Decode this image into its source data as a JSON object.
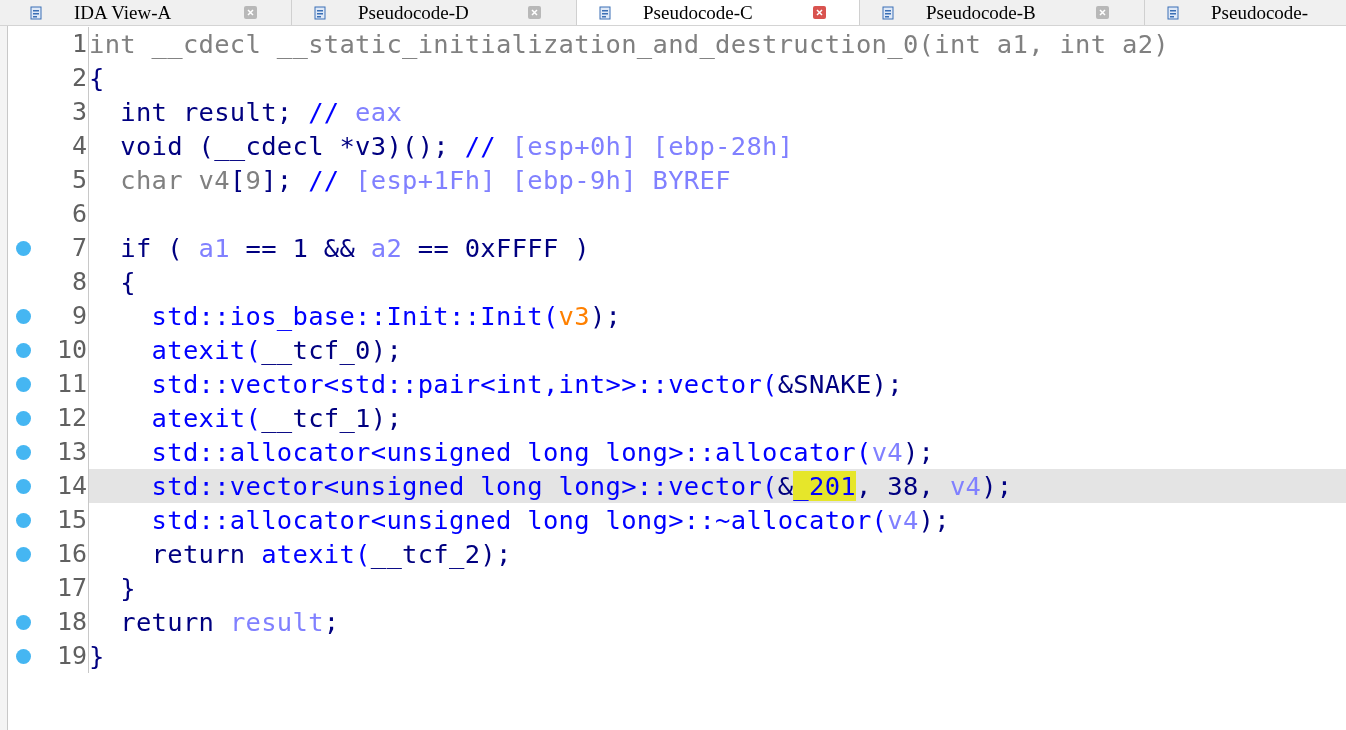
{
  "tabs": [
    {
      "label": "IDA View-A",
      "selected": false
    },
    {
      "label": "Pseudocode-D",
      "selected": false
    },
    {
      "label": "Pseudocode-C",
      "selected": true
    },
    {
      "label": "Pseudocode-B",
      "selected": false
    },
    {
      "label": "Pseudocode-",
      "selected": false
    }
  ],
  "code_lines": [
    {
      "number": "1",
      "breakpoint": false,
      "current": false,
      "tokens": [
        {
          "kind": "gray",
          "text": "int __cdecl __static_initialization_and_destruction_0(int a1, int a2)"
        }
      ]
    },
    {
      "number": "2",
      "breakpoint": false,
      "current": false,
      "tokens": [
        {
          "kind": "plain",
          "text": "{"
        }
      ]
    },
    {
      "number": "3",
      "breakpoint": false,
      "current": false,
      "tokens": [
        {
          "kind": "plain",
          "text": "  int result; "
        },
        {
          "kind": "comment",
          "text": "// "
        },
        {
          "kind": "var",
          "text": "eax"
        }
      ]
    },
    {
      "number": "4",
      "breakpoint": false,
      "current": false,
      "tokens": [
        {
          "kind": "plain",
          "text": "  void (__cdecl *v3)(); "
        },
        {
          "kind": "comment",
          "text": "// "
        },
        {
          "kind": "var",
          "text": "[esp+0h] [ebp-28h]"
        }
      ]
    },
    {
      "number": "5",
      "breakpoint": false,
      "current": false,
      "tokens": [
        {
          "kind": "gray",
          "text": "  char v4"
        },
        {
          "kind": "plain",
          "text": "["
        },
        {
          "kind": "gray",
          "text": "9"
        },
        {
          "kind": "plain",
          "text": "]; "
        },
        {
          "kind": "comment",
          "text": "// "
        },
        {
          "kind": "var",
          "text": "[esp+1Fh] [ebp-9h] BYREF"
        }
      ]
    },
    {
      "number": "6",
      "breakpoint": false,
      "current": false
    },
    {
      "number": "7",
      "breakpoint": true,
      "current": false,
      "tokens": [
        {
          "kind": "plain",
          "text": "  if ( "
        },
        {
          "kind": "var",
          "text": "a1"
        },
        {
          "kind": "plain",
          "text": " == 1 && "
        },
        {
          "kind": "var",
          "text": "a2"
        },
        {
          "kind": "plain",
          "text": " == 0xFFFF )"
        }
      ]
    },
    {
      "number": "8",
      "breakpoint": false,
      "current": false,
      "tokens": [
        {
          "kind": "plain",
          "text": "  {"
        }
      ]
    },
    {
      "number": "9",
      "breakpoint": true,
      "current": false,
      "tokens": [
        {
          "kind": "call",
          "text": "    std::ios_base::Init::Init("
        },
        {
          "kind": "arg",
          "text": "v3"
        },
        {
          "kind": "plain",
          "text": ");"
        }
      ]
    },
    {
      "number": "10",
      "breakpoint": true,
      "current": false,
      "tokens": [
        {
          "kind": "call",
          "text": "    atexit("
        },
        {
          "kind": "plain",
          "text": "__tcf_0);"
        }
      ]
    },
    {
      "number": "11",
      "breakpoint": true,
      "current": false,
      "tokens": [
        {
          "kind": "call",
          "text": "    std::vector<std::pair<int,int>>::vector("
        },
        {
          "kind": "plain",
          "text": "&SNAKE);"
        }
      ]
    },
    {
      "number": "12",
      "breakpoint": true,
      "current": false,
      "tokens": [
        {
          "kind": "call",
          "text": "    atexit("
        },
        {
          "kind": "plain",
          "text": "__tcf_1);"
        }
      ]
    },
    {
      "number": "13",
      "breakpoint": true,
      "current": false,
      "tokens": [
        {
          "kind": "call",
          "text": "    std::allocator<unsigned long long>::allocator("
        },
        {
          "kind": "var",
          "text": "v4"
        },
        {
          "kind": "plain",
          "text": ");"
        }
      ]
    },
    {
      "number": "14",
      "breakpoint": true,
      "current": true,
      "tokens": [
        {
          "kind": "call",
          "text": "    std::vector<unsigned long long>::vector("
        },
        {
          "kind": "plain",
          "text": "&"
        },
        {
          "kind": "highlight",
          "text": "_201"
        },
        {
          "kind": "plain",
          "text": ", 38, "
        },
        {
          "kind": "var",
          "text": "v4"
        },
        {
          "kind": "plain",
          "text": ");"
        }
      ]
    },
    {
      "number": "15",
      "breakpoint": true,
      "current": false,
      "tokens": [
        {
          "kind": "call",
          "text": "    std::allocator<unsigned long long>::~allocator("
        },
        {
          "kind": "var",
          "text": "v4"
        },
        {
          "kind": "plain",
          "text": ");"
        }
      ]
    },
    {
      "number": "16",
      "breakpoint": true,
      "current": false,
      "tokens": [
        {
          "kind": "plain",
          "text": "    return "
        },
        {
          "kind": "call",
          "text": "atexit("
        },
        {
          "kind": "plain",
          "text": "__tcf_2);"
        }
      ]
    },
    {
      "number": "17",
      "breakpoint": false,
      "current": false,
      "tokens": [
        {
          "kind": "plain",
          "text": "  }"
        }
      ]
    },
    {
      "number": "18",
      "breakpoint": true,
      "current": false,
      "tokens": [
        {
          "kind": "plain",
          "text": "  return "
        },
        {
          "kind": "var",
          "text": "result"
        },
        {
          "kind": "plain",
          "text": ";"
        }
      ]
    },
    {
      "number": "19",
      "breakpoint": true,
      "current": false,
      "tokens": [
        {
          "kind": "plain",
          "text": "}"
        }
      ]
    }
  ]
}
